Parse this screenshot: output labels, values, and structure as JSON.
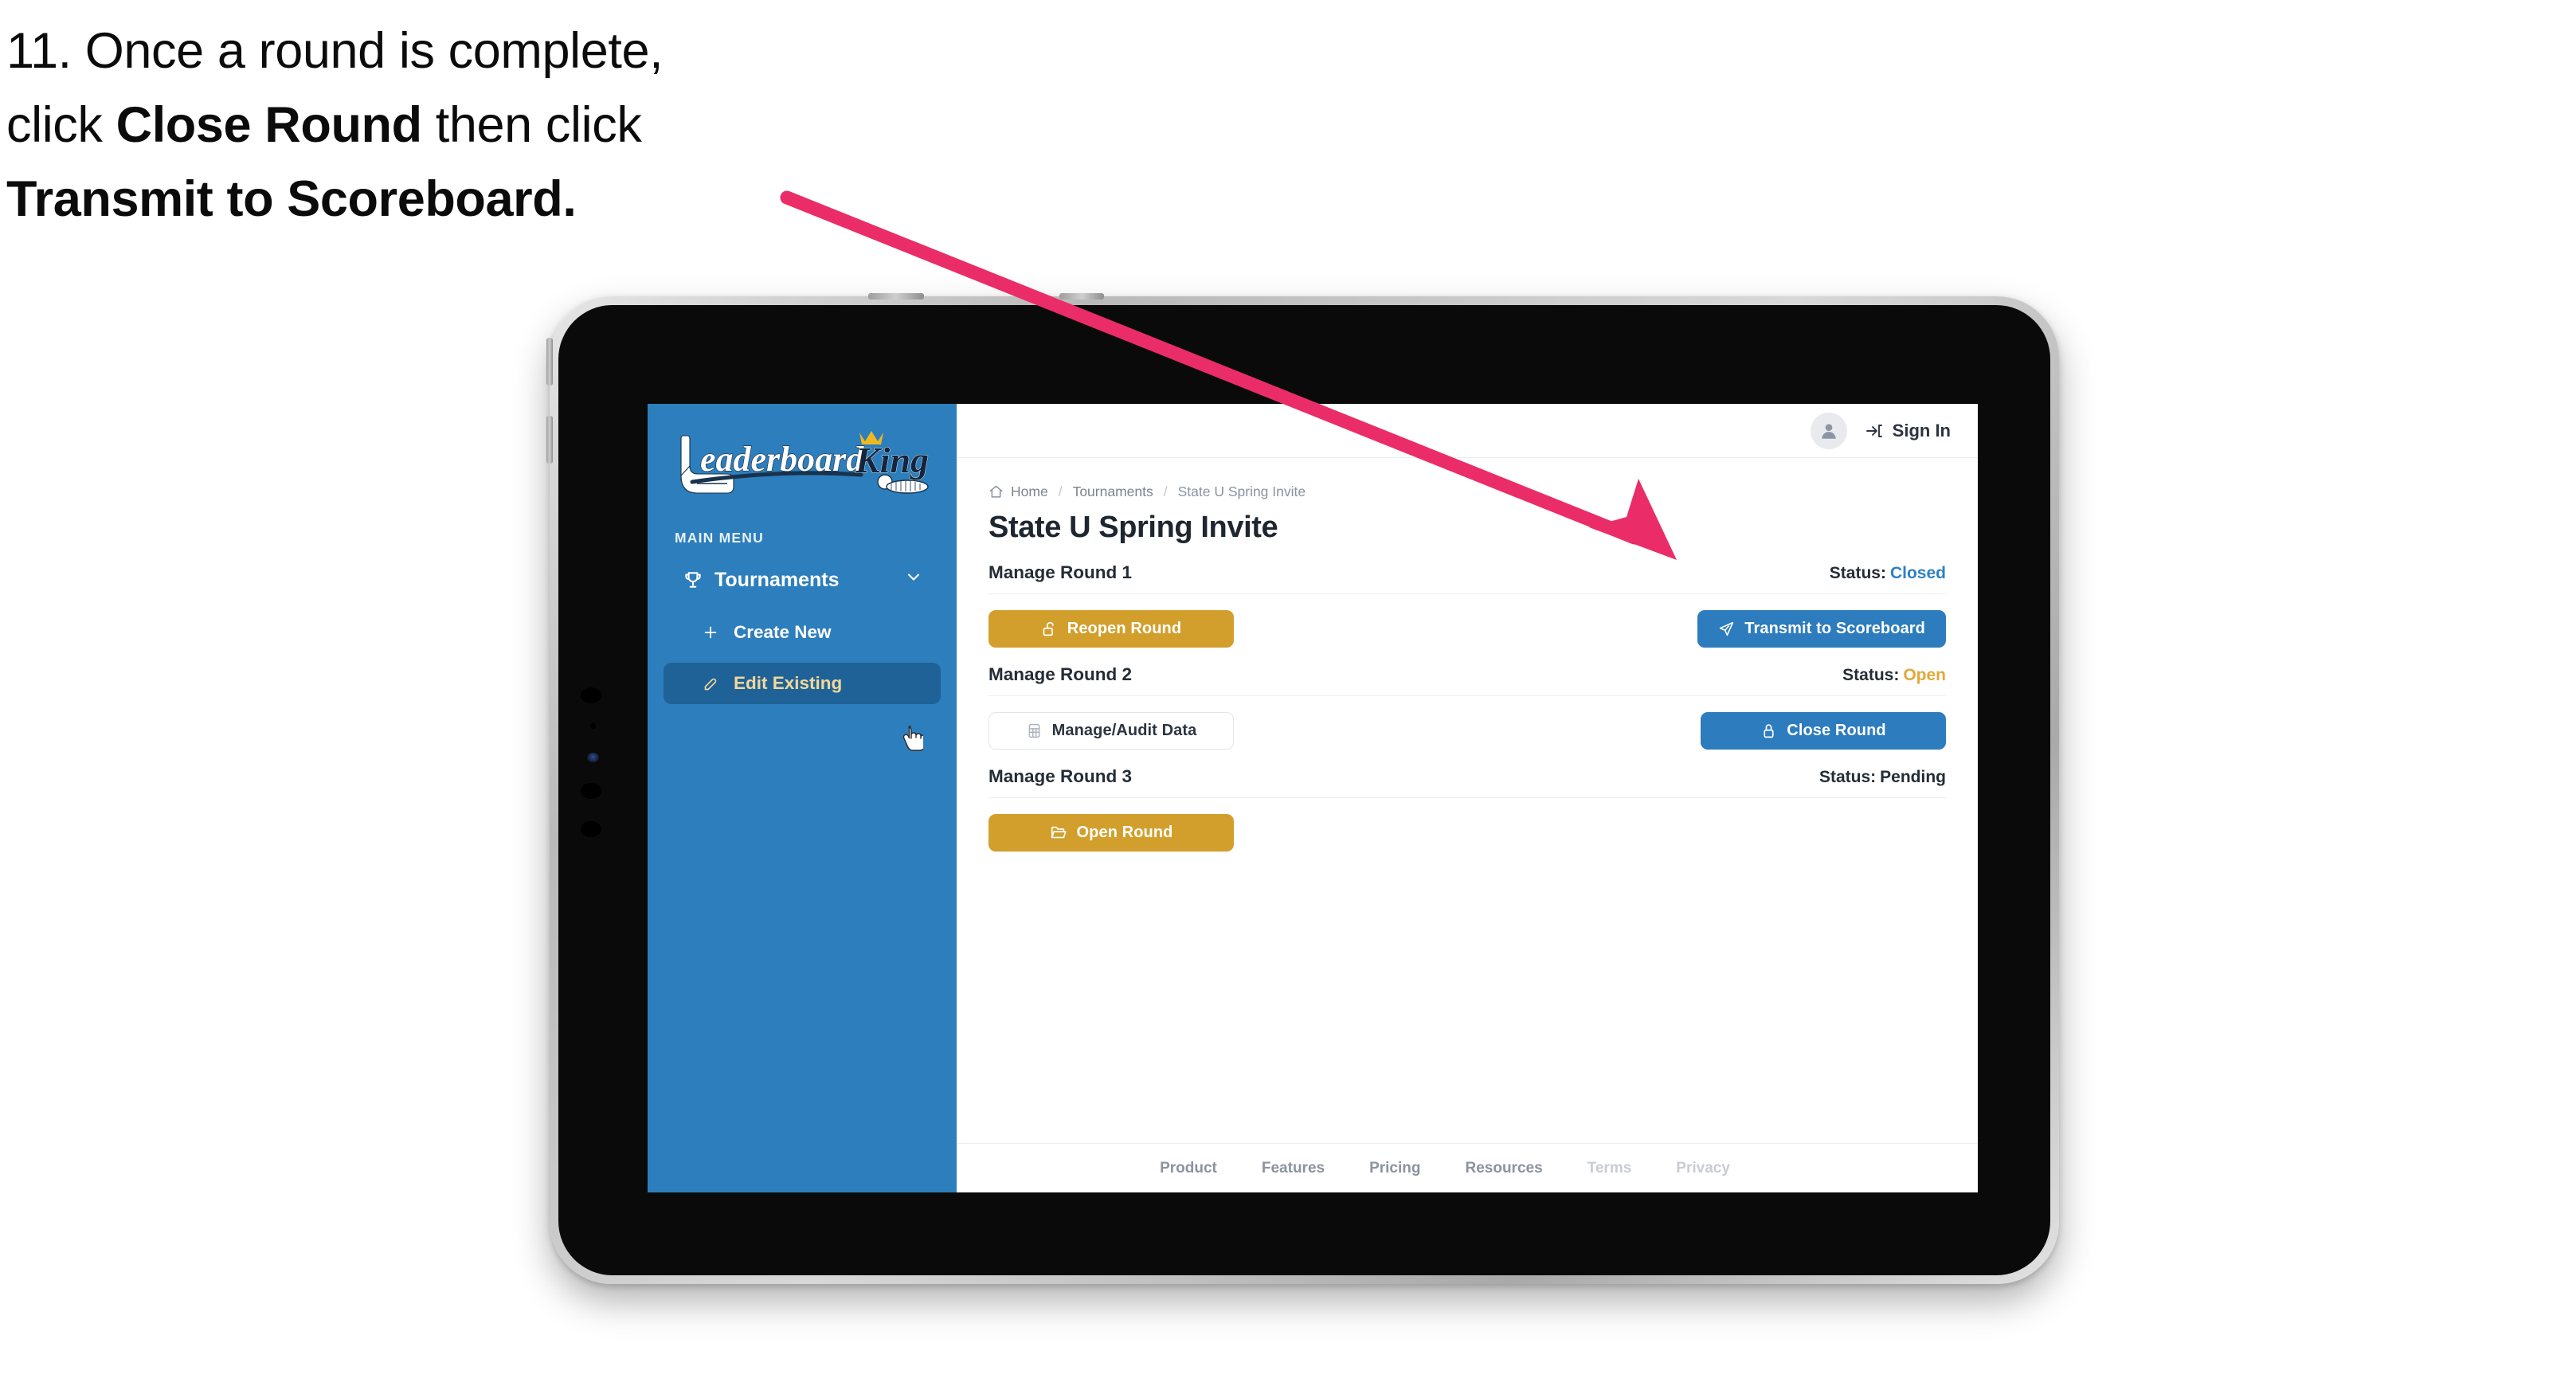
{
  "caption": {
    "line1_prefix": "11. Once a round is complete,",
    "line2_prefix": "click ",
    "line2_bold": "Close Round",
    "line2_suffix": " then click",
    "line3_bold": "Transmit to Scoreboard."
  },
  "annotation": {
    "arrow_color": "#ea2d68"
  },
  "sidebar": {
    "logo_primary": "Leaderboard",
    "logo_secondary": "King",
    "section_label": "MAIN MENU",
    "items": [
      {
        "label": "Tournaments",
        "icon": "trophy-icon",
        "chevron": "chevron-down-icon",
        "active": false
      },
      {
        "label": "Create New",
        "icon": "plus-icon",
        "active": false
      },
      {
        "label": "Edit Existing",
        "icon": "edit-pencil-icon",
        "active": true
      }
    ],
    "background_color": "#2d7ebc",
    "active_color": "#1f6298",
    "active_text_color": "#f2d79a"
  },
  "topbar": {
    "avatar_icon": "user-avatar-icon",
    "signin_icon": "sign-in-icon",
    "signin_label": "Sign In"
  },
  "breadcrumb": {
    "home_icon": "home-icon",
    "items": [
      "Home",
      "Tournaments",
      "State U Spring Invite"
    ],
    "separator": "/"
  },
  "main": {
    "page_title": "State U Spring Invite",
    "status_prefix": "Status:",
    "rounds": [
      {
        "name": "Manage Round 1",
        "status": "Closed",
        "status_class": "st-closed",
        "left_button": {
          "label": "Reopen Round",
          "icon": "unlock-icon",
          "style": "gold"
        },
        "right_button": {
          "label": "Transmit to Scoreboard",
          "icon": "paper-plane-icon",
          "style": "blue"
        }
      },
      {
        "name": "Manage Round 2",
        "status": "Open",
        "status_class": "st-open",
        "left_button": {
          "label": "Manage/Audit Data",
          "icon": "table-grid-icon",
          "style": "ghost"
        },
        "right_button": {
          "label": "Close Round",
          "icon": "lock-icon",
          "style": "blue"
        }
      },
      {
        "name": "Manage Round 3",
        "status": "Pending",
        "status_class": "st-pending",
        "left_button": {
          "label": "Open Round",
          "icon": "open-folder-icon",
          "style": "gold"
        },
        "right_button": null
      }
    ]
  },
  "footer": {
    "links": [
      {
        "label": "Product",
        "muted": false
      },
      {
        "label": "Features",
        "muted": false
      },
      {
        "label": "Pricing",
        "muted": false
      },
      {
        "label": "Resources",
        "muted": false
      },
      {
        "label": "Terms",
        "muted": true
      },
      {
        "label": "Privacy",
        "muted": true
      }
    ]
  },
  "colors": {
    "brand_blue": "#2d7ebc",
    "gold": "#d29f2c",
    "button_blue": "#2d7cbd",
    "status_open": "#e0a83a",
    "status_closed": "#2f80c4",
    "arrow_pink": "#ea2d68"
  }
}
